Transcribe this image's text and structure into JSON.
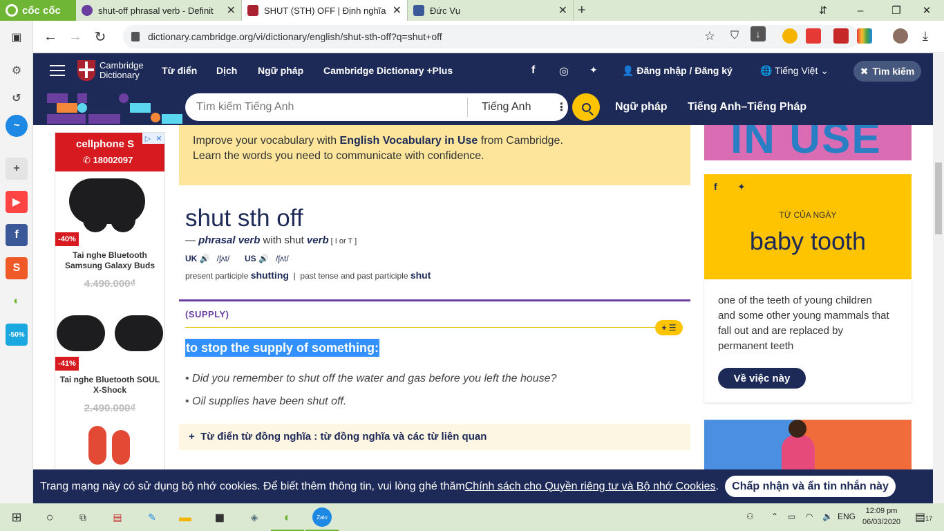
{
  "browser": {
    "brand": "cốc cốc",
    "tabs": [
      {
        "label": "shut-off phrasal verb - Definit",
        "active": false,
        "icon_color": "#6a3fa0"
      },
      {
        "label": "SHUT (STH) OFF | Định nghĩa",
        "active": true,
        "icon_color": "#a8232f"
      },
      {
        "label": "Đức Vụ",
        "active": false,
        "icon_color": "#3b5998"
      }
    ],
    "url": "dictionary.cambridge.org/vi/dictionary/english/shut-sth-off?q=shut+off",
    "new_tab": "+",
    "window_controls": {
      "minimize": "–",
      "restore": "❐",
      "close": "✕"
    }
  },
  "site_header": {
    "logo_line1": "Cambridge",
    "logo_line2": "Dictionary",
    "nav": [
      "Từ điển",
      "Dịch",
      "Ngữ pháp",
      "Cambridge Dictionary +Plus"
    ],
    "social": [
      "f",
      "◎",
      "🐦"
    ],
    "login": "Đăng nhập / Đăng ký",
    "language": "Tiếng Việt",
    "search_toggle": "Tìm kiếm"
  },
  "search": {
    "placeholder": "Tìm kiếm Tiếng Anh",
    "dictionary": "Tiếng Anh",
    "links": [
      "Ngữ pháp",
      "Tiếng Anh–Tiếng Pháp"
    ]
  },
  "ad": {
    "brand": "cellphone S",
    "phone": "18002097",
    "products": [
      {
        "discount": "-40%",
        "name": "Tai nghe Bluetooth Samsung Galaxy Buds",
        "price": "4.490.000₫"
      },
      {
        "discount": "-41%",
        "name": "Tai nghe Bluetooth SOUL X-Shock",
        "price": "2.490.000₫"
      }
    ]
  },
  "promo": {
    "line1_pre": "Improve your vocabulary with ",
    "line1_bold": "English Vocabulary in Use",
    "line1_post": " from Cambridge.",
    "line2": "Learn the words you need to communicate with confidence."
  },
  "entry": {
    "headword": "shut sth off",
    "pos_dash": "— ",
    "pos": "phrasal verb",
    "with_text": " with shut ",
    "with_pos": "verb",
    "grammar": " [ I or T ]",
    "uk_label": "UK",
    "uk_ipa": "/ʃʌt/",
    "us_label": "US",
    "us_ipa": "/ʃʌt/",
    "pp_label": "present participle ",
    "pp_value": "shutting",
    "sep": "  |  ",
    "pt_label": "past tense and past participle ",
    "pt_value": "shut",
    "guideword": "(SUPPLY)",
    "definition": "to stop the supply of something:",
    "examples": [
      "Did you remember to shut off the water and gas before you left the house?",
      "Oil supplies have been shut off."
    ],
    "thesaurus": "Từ điển từ đồng nghĩa : từ đồng nghĩa và các từ liên quan",
    "add_list": "+ ☰"
  },
  "right": {
    "banner_text": "IN USE",
    "wotd_label": "TỪ CỦA NGÀY",
    "wotd_word": "baby tooth",
    "wotd_def": "one of the teeth of young children and some other young mammals that fall out and are replaced by permanent teeth",
    "wotd_button": "Về việc này"
  },
  "cookie": {
    "text": "Trang mạng này có sử dụng bộ nhớ cookies. Để biết thêm thông tin, vui lòng ghé thăm ",
    "link": "Chính sách cho Quyền riêng tư và Bộ nhớ Cookies",
    "after": ".",
    "button": "Chấp nhận và ẩn tin nhắn này"
  },
  "taskbar": {
    "lang": "ENG",
    "time": "12:09 pm",
    "date": "06/03/2020",
    "notif_count": "17"
  },
  "colors": {
    "navy": "#1d2a57",
    "yellow": "#fec400",
    "purple": "#6a3fa0",
    "highlight": "#3390ff"
  }
}
